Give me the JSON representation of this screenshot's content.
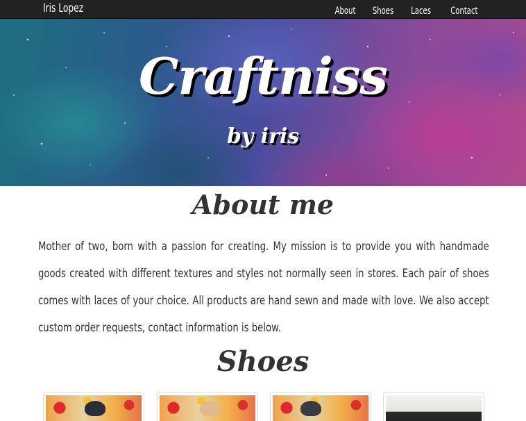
{
  "navbar": {
    "brand": "Iris Lopez",
    "links": [
      "About",
      "Shoes",
      "Laces",
      "Contact"
    ]
  },
  "hero": {
    "title": "Craftniss",
    "subtitle": "by iris"
  },
  "about": {
    "heading": "About me",
    "text": "Mother of two, born with a passion for creating. My mission is to provide you with handmade goods created with different textures and styles not normally seen in stores. Each pair of shoes comes with laces of your choice. All products are hand sewn and made with love. We also accept custom order requests, contact information is below."
  },
  "shoes": {
    "heading": "Shoes"
  },
  "colors": {
    "navbar_bg": "#222222",
    "heading_text": "#333333"
  }
}
